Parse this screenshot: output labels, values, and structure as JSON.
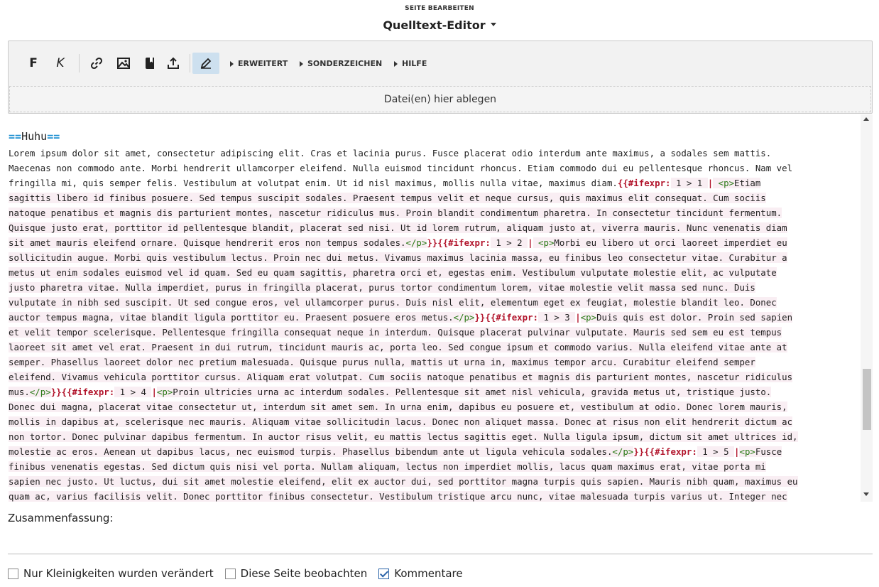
{
  "header": {
    "subtitle": "SEITE BEARBEITEN",
    "title": "Quelltext-Editor"
  },
  "toolbar": {
    "bold_label": "F",
    "italic_label": "K",
    "advanced_label": "ERWEITERT",
    "special_chars_label": "SONDERZEICHEN",
    "help_label": "HILFE",
    "dropzone_text": "Datei(en) hier ablegen"
  },
  "editor": {
    "heading_marker_open": "==",
    "heading_text": "Huhu",
    "heading_marker_close": "==",
    "lines": [
      "Lorem ipsum dolor sit amet, consectetur adipiscing elit. Cras et lacinia purus. Fusce placerat odio interdum ante maximus, a sodales sem mattis.",
      "Maecenas non commodo ante. Morbi hendrerit ullamcorper eleifend. Nulla euismod tincidunt rhoncus. Etiam commodo dui eu pellentesque rhoncus. Nam vel",
      "fringilla mi, quis semper felis. Vestibulum at volutpat enim. Ut id nisl maximus, mollis nulla vitae, maximus diam.{{#ifexpr: 1 > 1 | <p>Etiam",
      "sagittis libero id finibus posuere. Sed tempus suscipit sodales. Praesent tempus velit et neque cursus, quis maximus elit consequat. Cum sociis",
      "natoque penatibus et magnis dis parturient montes, nascetur ridiculus mus. Proin blandit condimentum pharetra. In consectetur tincidunt fermentum.",
      "Quisque justo erat, porttitor id pellentesque blandit, placerat sed nisi. Ut id lorem rutrum, aliquam justo at, viverra mauris. Nunc venenatis diam",
      "sit amet mauris eleifend ornare. Quisque hendrerit eros non tempus sodales.</p>}}{{#ifexpr: 1 > 2 | <p>Morbi eu libero ut orci laoreet imperdiet eu",
      "sollicitudin augue. Morbi quis vestibulum lectus. Proin nec dui metus. Vivamus maximus lacinia massa, eu finibus leo consectetur vitae. Curabitur a",
      "metus ut enim sodales euismod vel id quam. Sed eu quam sagittis, pharetra orci et, egestas enim. Vestibulum vulputate molestie elit, ac vulputate",
      "justo pharetra vitae. Nulla imperdiet, purus in fringilla placerat, purus tortor condimentum lorem, vitae molestie velit massa sed nunc. Duis",
      "vulputate in nibh sed suscipit. Ut sed congue eros, vel ullamcorper purus. Duis nisl elit, elementum eget ex feugiat, molestie blandit leo. Donec",
      "auctor tempus magna, vitae blandit ligula porttitor eu. Praesent posuere eros metus.</p>}}{{#ifexpr: 1 > 3 |<p>Duis quis est dolor. Proin sed sapien",
      "et velit tempor scelerisque. Pellentesque fringilla consequat neque in interdum. Quisque placerat pulvinar vulputate. Mauris sed sem eu est tempus",
      "laoreet sit amet vel erat. Praesent in dui rutrum, tincidunt mauris ac, porta leo. Sed congue ipsum et commodo varius. Nulla eleifend vitae ante at",
      "semper. Phasellus laoreet dolor nec pretium malesuada. Quisque purus nulla, mattis ut urna in, maximus tempor arcu. Curabitur eleifend semper",
      "eleifend. Vivamus vehicula porttitor cursus. Aliquam erat volutpat. Cum sociis natoque penatibus et magnis dis parturient montes, nascetur ridiculus",
      "mus.</p>}}{{#ifexpr: 1 > 4 |<p>Proin ultricies urna ac interdum sodales. Pellentesque sit amet nisl vehicula, gravida metus ut, tristique justo.",
      "Donec dui magna, placerat vitae consectetur ut, interdum sit amet sem. In urna enim, dapibus eu posuere et, vestibulum at odio. Donec lorem mauris,",
      "mollis in dapibus at, scelerisque nec mauris. Aliquam vitae sollicitudin lacus. Donec non aliquet massa. Donec at risus non elit hendrerit dictum ac",
      "non tortor. Donec pulvinar dapibus fermentum. In auctor risus velit, eu mattis lectus sagittis eget. Nulla ligula ipsum, dictum sit amet ultrices id,",
      "molestie ac eros. Aenean ut dapibus lacus, nec euismod turpis. Phasellus bibendum ante ut ligula vehicula sodales.</p>}}{{#ifexpr: 1 > 5 |<p>Fusce",
      "finibus venenatis egestas. Sed dictum quis nisi vel porta. Nullam aliquam, lectus non imperdiet mollis, lacus quam maximus erat, vitae porta mi",
      "sapien nec justo. Ut luctus, dui sit amet molestie eleifend, elit ex auctor dui, sed porttitor magna turpis quis sapien. Mauris nibh quam, maximus eu",
      "quam ac, varius facilisis velit. Donec porttitor finibus consectetur. Vestibulum tristique arcu nunc, vitae malesuada turpis varius ut. Integer nec"
    ]
  },
  "summary": {
    "label": "Zusammenfassung:",
    "value": ""
  },
  "options": [
    {
      "label": "Nur Kleinigkeiten wurden verändert",
      "checked": false
    },
    {
      "label": "Diese Seite beobachten",
      "checked": false
    },
    {
      "label": "Kommentare",
      "checked": true
    }
  ]
}
